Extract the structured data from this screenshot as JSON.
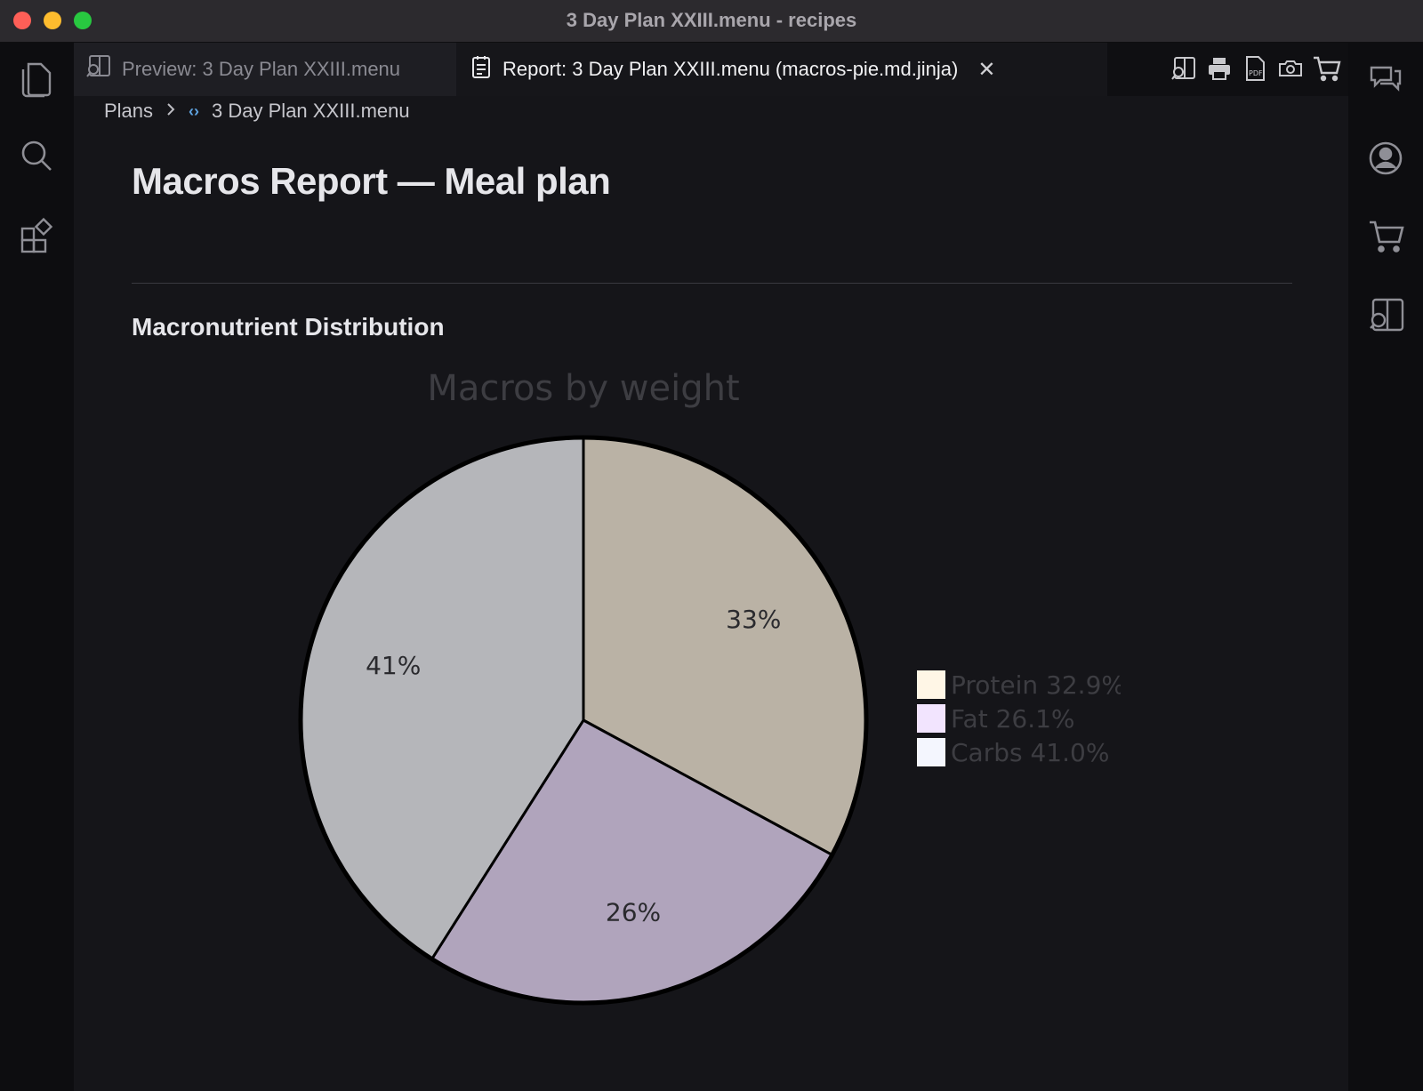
{
  "window": {
    "title": "3 Day Plan XXIII.menu - recipes"
  },
  "tabs": [
    {
      "label": "Preview: 3 Day Plan XXIII.menu",
      "active": false
    },
    {
      "label": "Report: 3 Day Plan XXIII.menu (macros-pie.md.jinja)",
      "active": true
    }
  ],
  "toolbar_icons": [
    "split-preview-icon",
    "print-icon",
    "pdf-icon",
    "camera-icon",
    "cart-icon"
  ],
  "activity_icons": [
    "files-icon",
    "search-icon",
    "extensions-icon"
  ],
  "right_icons": [
    "chat-icon",
    "account-icon",
    "cart-icon",
    "split-preview-icon"
  ],
  "breadcrumb": {
    "root": "Plans",
    "file": "3 Day Plan XXIII.menu"
  },
  "report": {
    "title": "Macros Report — Meal plan",
    "section": "Macronutrient Distribution"
  },
  "chart_data": {
    "type": "pie",
    "title": "Macros by weight",
    "slices": [
      {
        "label": "Protein",
        "value": 32.9,
        "slice_label": "33%",
        "legend": "Protein 32.9%",
        "color": "#bab2a5",
        "legend_color": "#fff6e6"
      },
      {
        "label": "Fat",
        "value": 26.1,
        "slice_label": "26%",
        "legend": "Fat 26.1%",
        "color": "#b0a4bc",
        "legend_color": "#f2e4fe"
      },
      {
        "label": "Carbs",
        "value": 41.0,
        "slice_label": "41%",
        "legend": "Carbs 41.0%",
        "color": "#b5b6ba",
        "legend_color": "#f4f6fe"
      }
    ],
    "start_angle": "12 o'clock, clockwise",
    "legend_position": "right"
  }
}
